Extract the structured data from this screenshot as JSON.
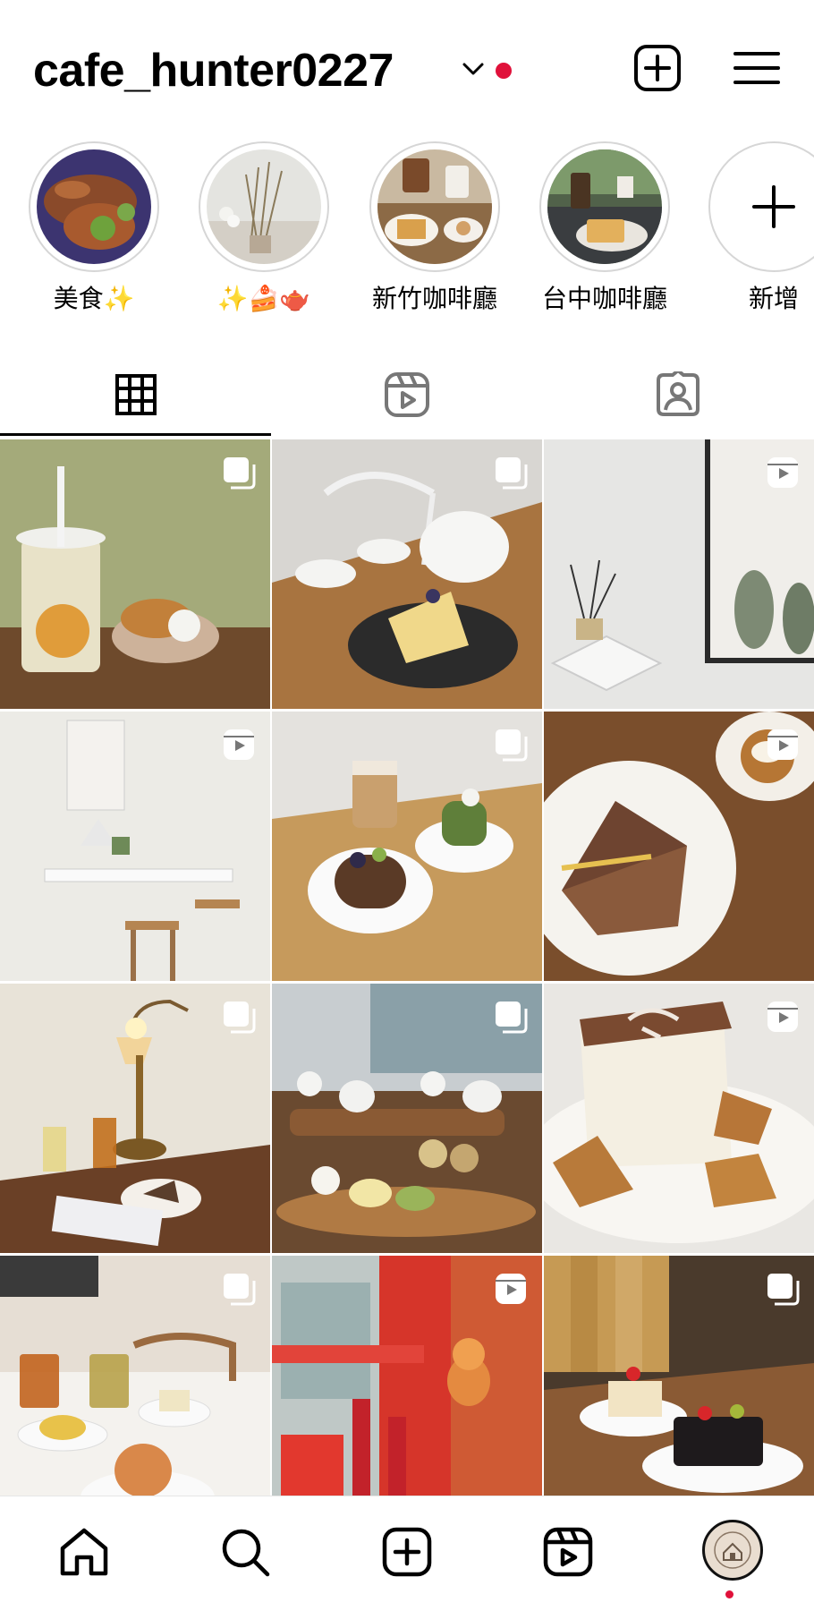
{
  "profile": {
    "username": "cafe_hunter0227"
  },
  "icons": {
    "switch_account": "chevron-down-icon",
    "new_post": "plus-square-icon",
    "menu": "hamburger-menu-icon"
  },
  "colors": {
    "notification_dot": "#e0113a",
    "active_tab_underline": "#000000"
  },
  "highlights": [
    {
      "label": "美食✨"
    },
    {
      "label": "✨🍰🫖"
    },
    {
      "label": "新竹咖啡廳"
    },
    {
      "label": "台中咖啡廳"
    },
    {
      "label": "新增"
    }
  ],
  "tabs": [
    {
      "name": "posts-grid",
      "icon": "grid-icon",
      "active": true
    },
    {
      "name": "reels",
      "icon": "reels-icon",
      "active": false
    },
    {
      "name": "tagged",
      "icon": "tagged-person-icon",
      "active": false
    }
  ],
  "grid_posts": [
    {
      "subject": "iced drink with croffle",
      "type": "carousel"
    },
    {
      "subject": "crepe cake with tea set",
      "type": "carousel"
    },
    {
      "subject": "cafe wall with diffuser",
      "type": "reel"
    },
    {
      "subject": "cafe seating corner",
      "type": "reel"
    },
    {
      "subject": "latte and cakes",
      "type": "carousel"
    },
    {
      "subject": "tiramisu and pudding",
      "type": "reel"
    },
    {
      "subject": "lamp with drinks and cake",
      "type": "carousel"
    },
    {
      "subject": "tea ceremony dessert set",
      "type": "carousel"
    },
    {
      "subject": "cake with cocoa character",
      "type": "reel"
    },
    {
      "subject": "tea and tarts",
      "type": "carousel"
    },
    {
      "subject": "red cafe interior",
      "type": "reel"
    },
    {
      "subject": "coffee bags and cakes",
      "type": "carousel"
    }
  ],
  "bottom_nav": [
    {
      "name": "home",
      "icon": "home-icon"
    },
    {
      "name": "search",
      "icon": "search-icon"
    },
    {
      "name": "create",
      "icon": "plus-square-icon"
    },
    {
      "name": "reels",
      "icon": "reels-icon"
    },
    {
      "name": "profile",
      "icon": "avatar"
    }
  ]
}
